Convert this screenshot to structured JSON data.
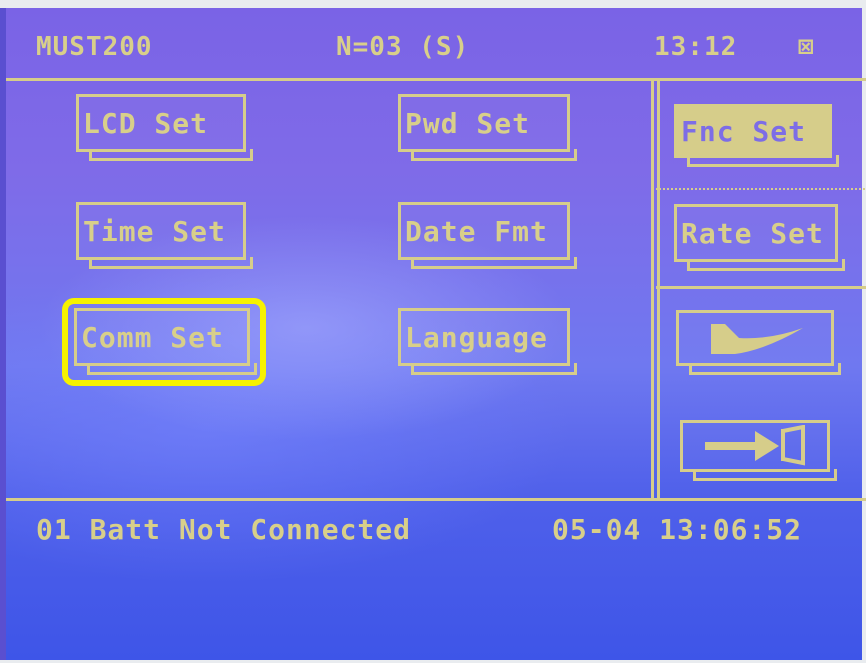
{
  "header": {
    "model": "MUST200",
    "mode": "N=03 (S)",
    "time": "13:12",
    "alarm_icon": "⊠"
  },
  "buttons": {
    "lcd_set": "LCD Set",
    "pwd_set": "Pwd Set",
    "fnc_set": "Fnc Set",
    "time_set": "Time Set",
    "date_fmt": "Date Fmt",
    "rate_set": "Rate Set",
    "comm_set": "Comm Set",
    "language": "Language"
  },
  "icons": {
    "back": "back-arrow-icon",
    "exit": "exit-door-icon"
  },
  "status": {
    "message": "01 Batt Not Connected",
    "timestamp": "05-04 13:06:52"
  },
  "colors": {
    "lcd_text": "#d8cf8a",
    "highlight": "#f6f200",
    "screen_bg": "#6a6bec"
  }
}
